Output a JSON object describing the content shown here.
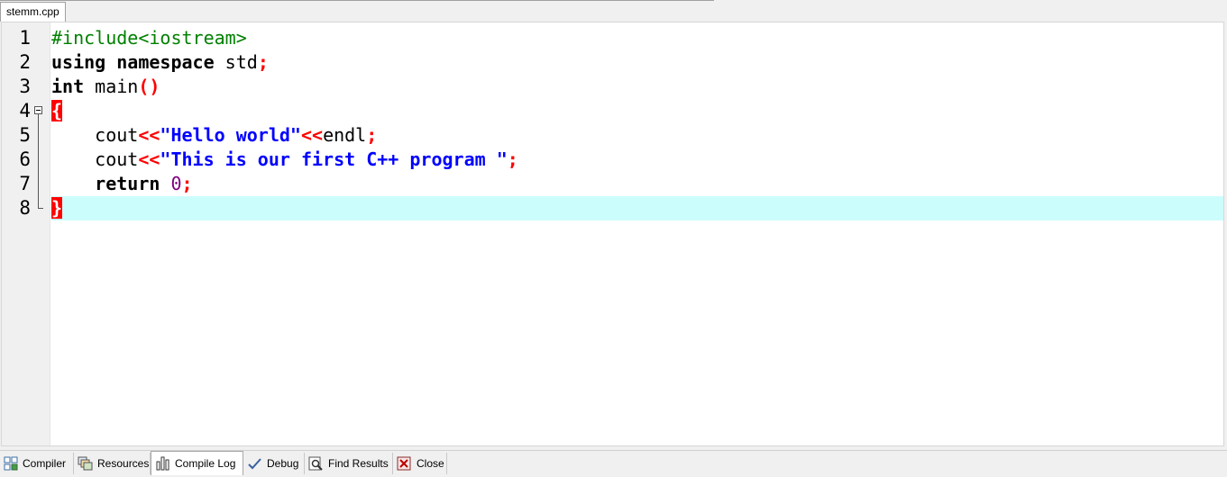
{
  "file_tab": {
    "label": "stemm.cpp"
  },
  "editor": {
    "line_numbers": [
      "1",
      "2",
      "3",
      "4",
      "5",
      "6",
      "7",
      "8"
    ],
    "current_line": 8,
    "lines": [
      [
        {
          "t": "#include<iostream>",
          "c": "pre"
        }
      ],
      [
        {
          "t": "using",
          "c": "kw"
        },
        {
          "t": " "
        },
        {
          "t": "namespace",
          "c": "kw"
        },
        {
          "t": " std"
        },
        {
          "t": ";",
          "c": "sym"
        }
      ],
      [
        {
          "t": "int",
          "c": "kw"
        },
        {
          "t": " main"
        },
        {
          "t": "()",
          "c": "sym"
        }
      ],
      [
        {
          "t": "{",
          "c": "brace"
        }
      ],
      [
        {
          "t": "    cout"
        },
        {
          "t": "<<",
          "c": "sym"
        },
        {
          "t": "\"Hello world\"",
          "c": "str"
        },
        {
          "t": "<<",
          "c": "sym"
        },
        {
          "t": "endl"
        },
        {
          "t": ";",
          "c": "sym"
        }
      ],
      [
        {
          "t": "    cout"
        },
        {
          "t": "<<",
          "c": "sym"
        },
        {
          "t": "\"This is our first C++ program \"",
          "c": "str"
        },
        {
          "t": ";",
          "c": "sym"
        }
      ],
      [
        {
          "t": "    "
        },
        {
          "t": "return",
          "c": "kw"
        },
        {
          "t": " "
        },
        {
          "t": "0",
          "c": "num"
        },
        {
          "t": ";",
          "c": "sym"
        }
      ],
      [
        {
          "t": "}",
          "c": "brace"
        }
      ]
    ]
  },
  "bottom_tabs": {
    "compiler": "Compiler",
    "resources": "Resources",
    "compile_log": "Compile Log",
    "debug": "Debug",
    "find_results": "Find Results",
    "close": "Close"
  },
  "colors": {
    "current_line_bg": "#ccfdfd",
    "preprocessor": "#008000",
    "string": "#0000ff",
    "symbol": "#ff0000",
    "number": "#800080"
  }
}
